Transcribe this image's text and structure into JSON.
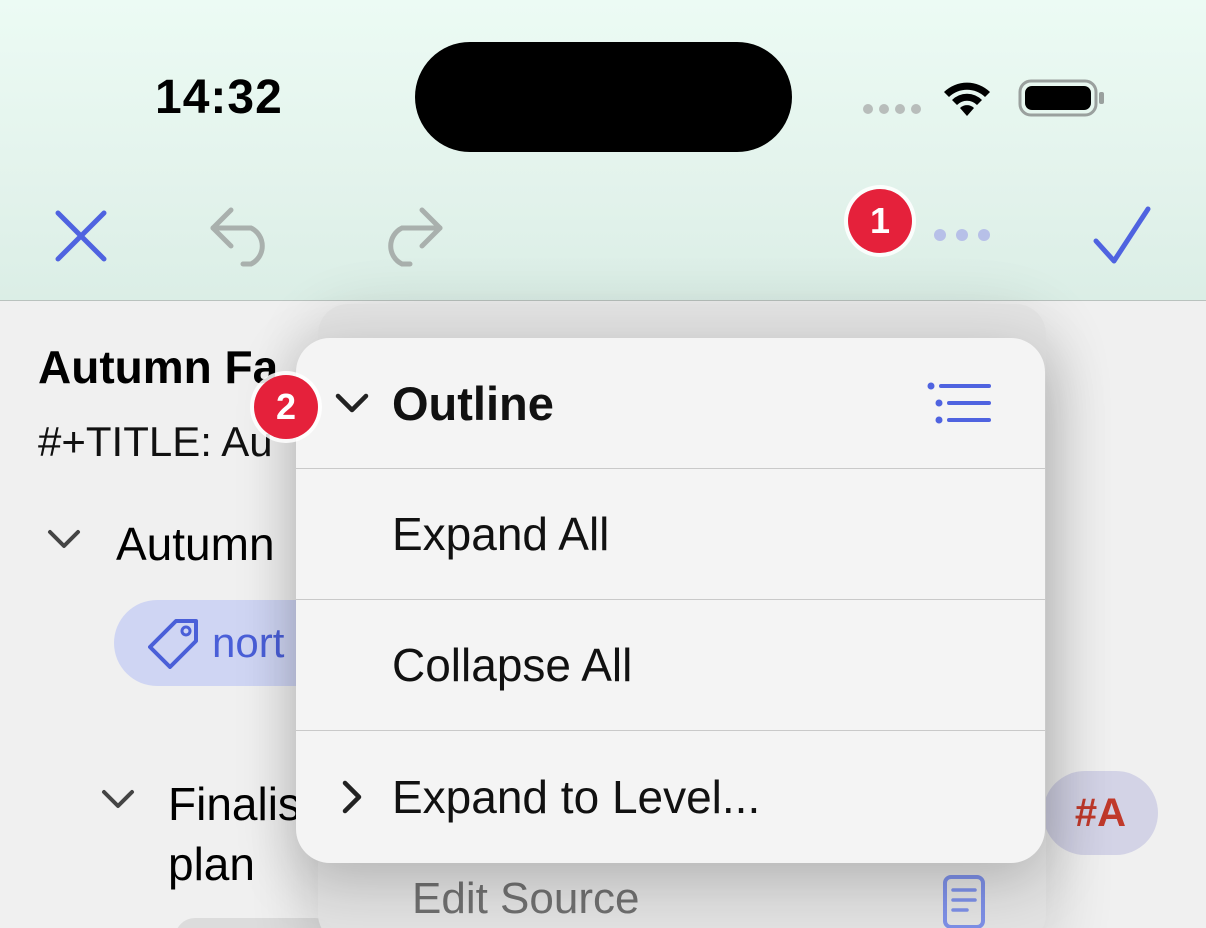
{
  "status_bar": {
    "time": "14:32"
  },
  "toolbar": {
    "close_icon": "close-icon",
    "undo_icon": "undo-icon",
    "redo_icon": "redo-icon",
    "more_icon": "more-horizontal-icon",
    "done_icon": "checkmark-icon",
    "badge_more": "1",
    "badge_outline": "2"
  },
  "document": {
    "title": "Autumn Fa",
    "meta_line": "#+TITLE: Au",
    "heading_1": "Autumn",
    "tag_label": "nort",
    "heading_2_line1": "Finalis",
    "heading_2_line2": "plan",
    "priority": "#A"
  },
  "menu": {
    "header_label": "Outline",
    "items": [
      {
        "label": "Expand All"
      },
      {
        "label": "Collapse All"
      },
      {
        "label": "Expand to Level..."
      }
    ],
    "underlying_item": "Edit Source"
  },
  "colors": {
    "accent": "#4f63e0",
    "badge": "#e5213b",
    "priority_text": "#c0392b"
  }
}
